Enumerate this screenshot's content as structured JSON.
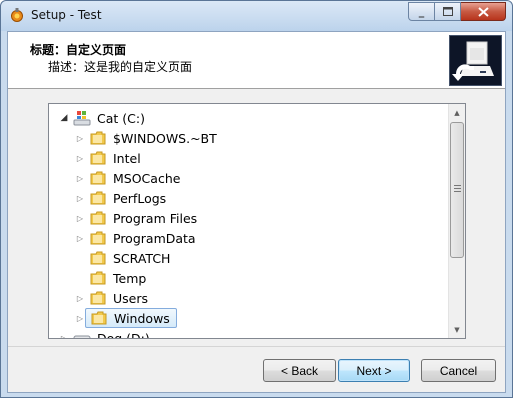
{
  "window": {
    "title": "Setup - Test"
  },
  "header": {
    "title": "标题：自定义页面",
    "subtitle": "描述：这是我的自定义页面"
  },
  "tree": {
    "root": {
      "label": "Cat (C:)",
      "expanded": true
    },
    "items": [
      {
        "label": "$WINDOWS.~BT",
        "expandable": true
      },
      {
        "label": "Intel",
        "expandable": true
      },
      {
        "label": "MSOCache",
        "expandable": true
      },
      {
        "label": "PerfLogs",
        "expandable": true
      },
      {
        "label": "Program Files",
        "expandable": true
      },
      {
        "label": "ProgramData",
        "expandable": true
      },
      {
        "label": "SCRATCH",
        "expandable": false
      },
      {
        "label": "Temp",
        "expandable": false
      },
      {
        "label": "Users",
        "expandable": true
      },
      {
        "label": "Windows",
        "expandable": true,
        "selected": true
      }
    ],
    "next_drive": {
      "label": "Dog (D:)"
    }
  },
  "buttons": {
    "back": "< Back",
    "next": "Next >",
    "cancel": "Cancel"
  },
  "colors": {
    "folder": "#f2c94c",
    "selection_border": "#84acdd",
    "close_button": "#c75a43"
  }
}
